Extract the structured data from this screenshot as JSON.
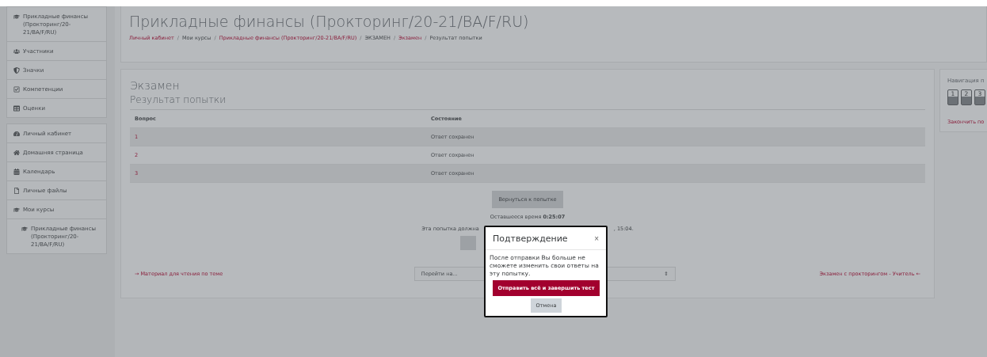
{
  "sidebar": {
    "groups": [
      [
        {
          "kind": "course",
          "label": "Прикладные финансы (Прокторинг/20-21/BA/F/RU)"
        },
        {
          "kind": "participants",
          "label": "Участники"
        },
        {
          "kind": "badges",
          "label": "Значки"
        },
        {
          "kind": "competencies",
          "label": "Компетенции"
        },
        {
          "kind": "grades",
          "label": "Оценки"
        }
      ],
      [
        {
          "kind": "dashboard",
          "label": "Личный кабинет"
        },
        {
          "kind": "home",
          "label": "Домашняя страница"
        },
        {
          "kind": "calendar",
          "label": "Календарь"
        },
        {
          "kind": "files",
          "label": "Личные файлы"
        },
        {
          "kind": "course",
          "label": "Мои курсы"
        },
        {
          "kind": "subcourse",
          "label": "Прикладные финансы (Прокторинг/20-21/BA/F/RU)"
        }
      ]
    ]
  },
  "header": {
    "title": "Прикладные финансы (Прокторинг/20-21/BA/F/RU)",
    "separator": "/",
    "breadcrumbs": [
      {
        "label": "Личный кабинет",
        "link": true
      },
      {
        "label": "Мои курсы",
        "link": false
      },
      {
        "label": "Прикладные финансы (Прокторинг/20-21/BA/F/RU)",
        "link": true
      },
      {
        "label": "ЭКЗАМЕН",
        "link": false
      },
      {
        "label": "Экзамен",
        "link": true
      },
      {
        "label": "Результат попытки",
        "link": false
      }
    ]
  },
  "main": {
    "title": "Экзамен",
    "subtitle": "Результат попытки",
    "table": {
      "columns": [
        "Вопрос",
        "Состояние"
      ],
      "rows": [
        [
          "1",
          "Ответ сохранен"
        ],
        [
          "2",
          "Ответ сохранен"
        ],
        [
          "3",
          "Ответ сохранен"
        ]
      ]
    },
    "return_button": "Вернуться к попытке",
    "time_label": "Оставшееся время",
    "time_value": "0:25:07",
    "note_before": "Эта попытка должна",
    "note_after": ", 15:04.",
    "prev_link": "→ Материал для чтения по теме",
    "jump_select": {
      "placeholder": "Перейти на...",
      "arrow": "⇕"
    },
    "next_link": "Экзамен с прокторингом - Учитель ←"
  },
  "navigation": {
    "title": "Навигация п",
    "buttons": [
      "1",
      "2",
      "3"
    ],
    "finish_link": "Закончить по"
  },
  "modal": {
    "title": "Подтверждение",
    "close": "×",
    "message": "После отправки Вы больше не сможете изменить свои ответы на эту попытку.",
    "submit_button": "Отправить всё и завершить тест",
    "cancel_button": "Отмена"
  }
}
